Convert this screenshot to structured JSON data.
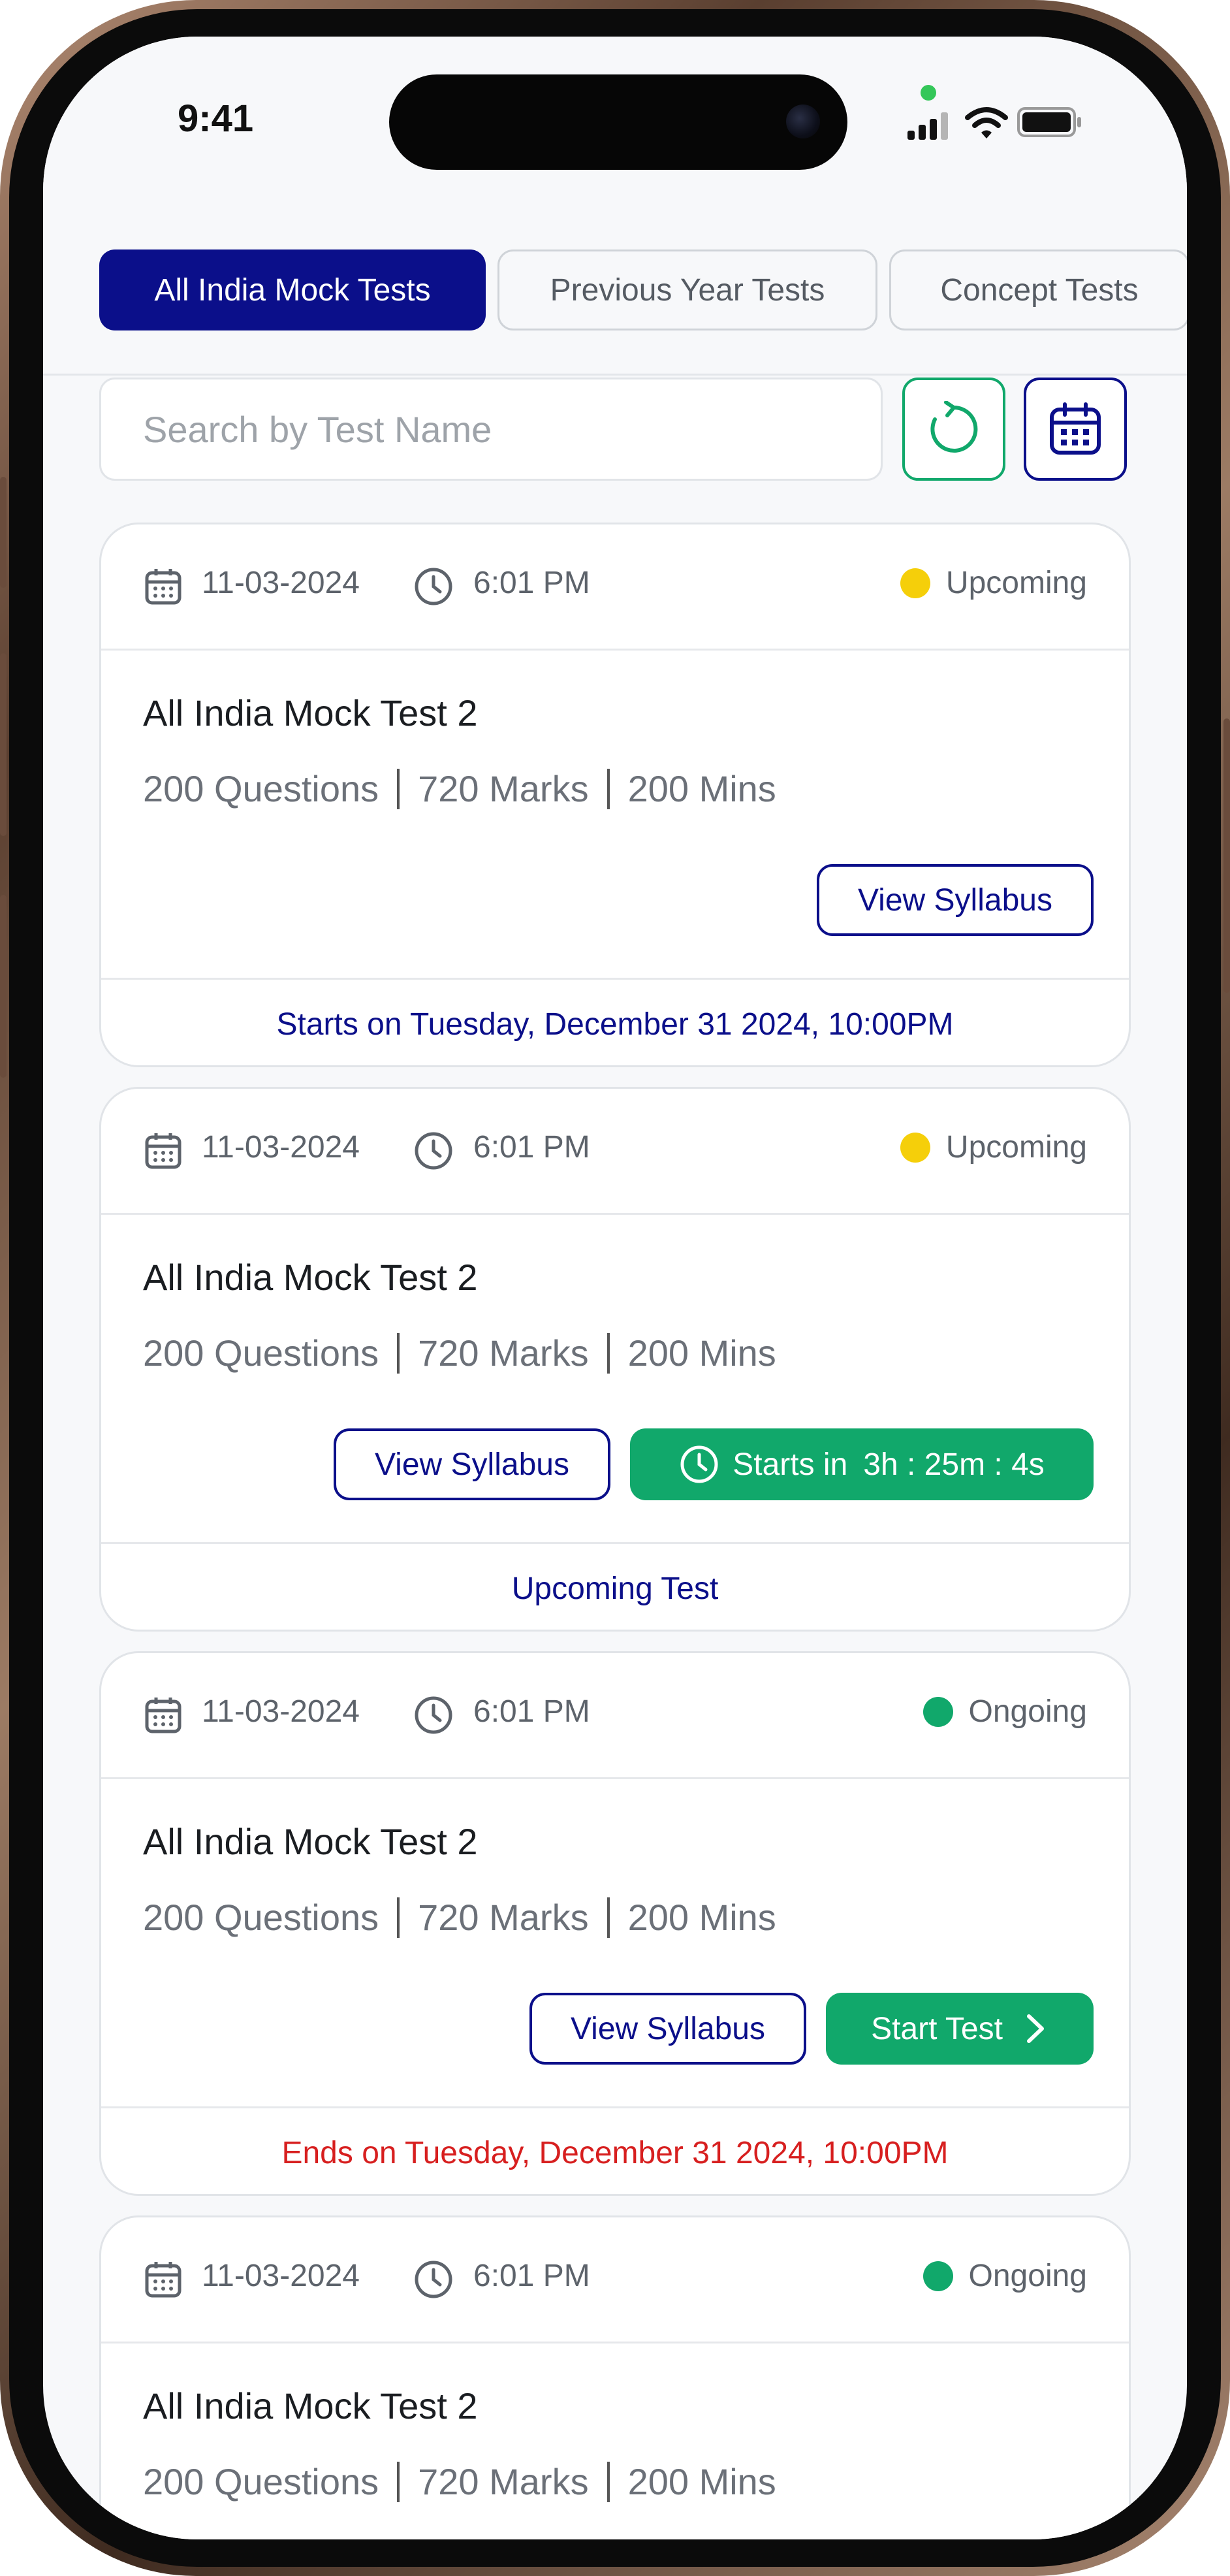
{
  "status_bar": {
    "time": "9:41"
  },
  "tabs": [
    {
      "label": "All India Mock Tests",
      "active": true
    },
    {
      "label": "Previous Year Tests",
      "active": false
    },
    {
      "label": "Concept Tests",
      "active": false
    }
  ],
  "search": {
    "placeholder": "Search by Test Name"
  },
  "colors": {
    "primary": "#0b0f8a",
    "green": "#11a86b",
    "upcoming": "#f5cf0a",
    "ongoing": "#11a86b",
    "danger": "#d71f1f"
  },
  "cards": [
    {
      "date": "11-03-2024",
      "time": "6:01 PM",
      "status": "Upcoming",
      "title": "All India Mock Test 2",
      "questions": "200 Questions",
      "marks": "720 Marks",
      "duration": "200 Mins",
      "syllabus_label": "View Syllabus",
      "footer": "Starts on Tuesday, December 31 2024, 10:00PM"
    },
    {
      "date": "11-03-2024",
      "time": "6:01 PM",
      "status": "Upcoming",
      "title": "All India Mock Test 2",
      "questions": "200 Questions",
      "marks": "720 Marks",
      "duration": "200 Mins",
      "syllabus_label": "View Syllabus",
      "countdown_prefix": "Starts in",
      "countdown": "3h : 25m : 4s",
      "footer": "Upcoming Test"
    },
    {
      "date": "11-03-2024",
      "time": "6:01 PM",
      "status": "Ongoing",
      "title": "All India Mock Test 2",
      "questions": "200 Questions",
      "marks": "720 Marks",
      "duration": "200 Mins",
      "syllabus_label": "View Syllabus",
      "start_label": "Start Test",
      "footer": "Ends on Tuesday, December 31 2024, 10:00PM"
    },
    {
      "date": "11-03-2024",
      "time": "6:01 PM",
      "status": "Ongoing",
      "title": "All India Mock Test 2",
      "questions": "200 Questions",
      "marks": "720 Marks",
      "duration": "200 Mins"
    }
  ]
}
